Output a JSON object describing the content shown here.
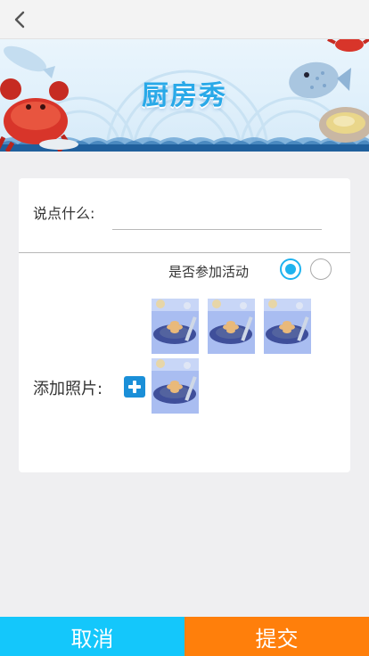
{
  "header": {
    "back_icon": "chevron-left-icon"
  },
  "banner": {
    "title": "厨房秀",
    "colors": {
      "title": "#29a9e8",
      "crab": "#d8352a",
      "waves": "#1f5f9c"
    }
  },
  "form": {
    "say_label": "说点什么:",
    "say_value": "",
    "activity_label": "是否参加活动",
    "activity_selected": "first",
    "photo_label": "添加照片:",
    "add_icon": "plus-icon",
    "photos": [
      "photo-1",
      "photo-2",
      "photo-3",
      "photo-4"
    ]
  },
  "actions": {
    "cancel_label": "取消",
    "submit_label": "提交",
    "colors": {
      "cancel": "#14c7fb",
      "submit": "#ff7f0b"
    }
  }
}
